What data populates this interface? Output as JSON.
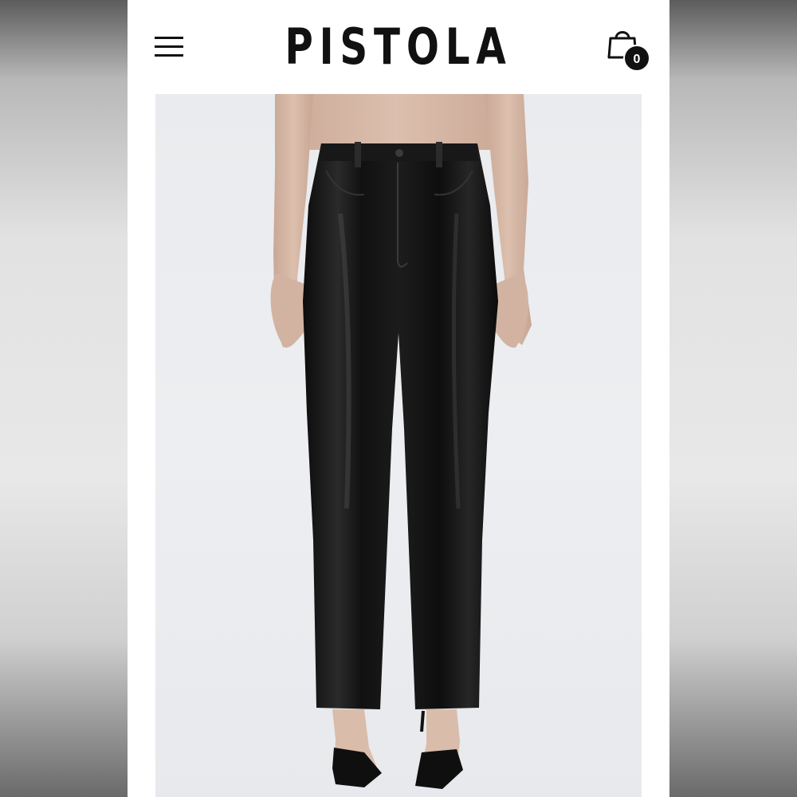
{
  "header": {
    "brand": "PISTOLA",
    "menu_icon": "hamburger-menu-icon",
    "cart_icon": "shopping-bag-icon",
    "cart_count": "0"
  },
  "product": {
    "image": "model-wearing-black-faux-leather-straight-leg-pants"
  },
  "colors": {
    "background": "#ffffff",
    "brand_text": "#111111",
    "photo_backdrop": "#eaecef",
    "pants": "#141414"
  }
}
